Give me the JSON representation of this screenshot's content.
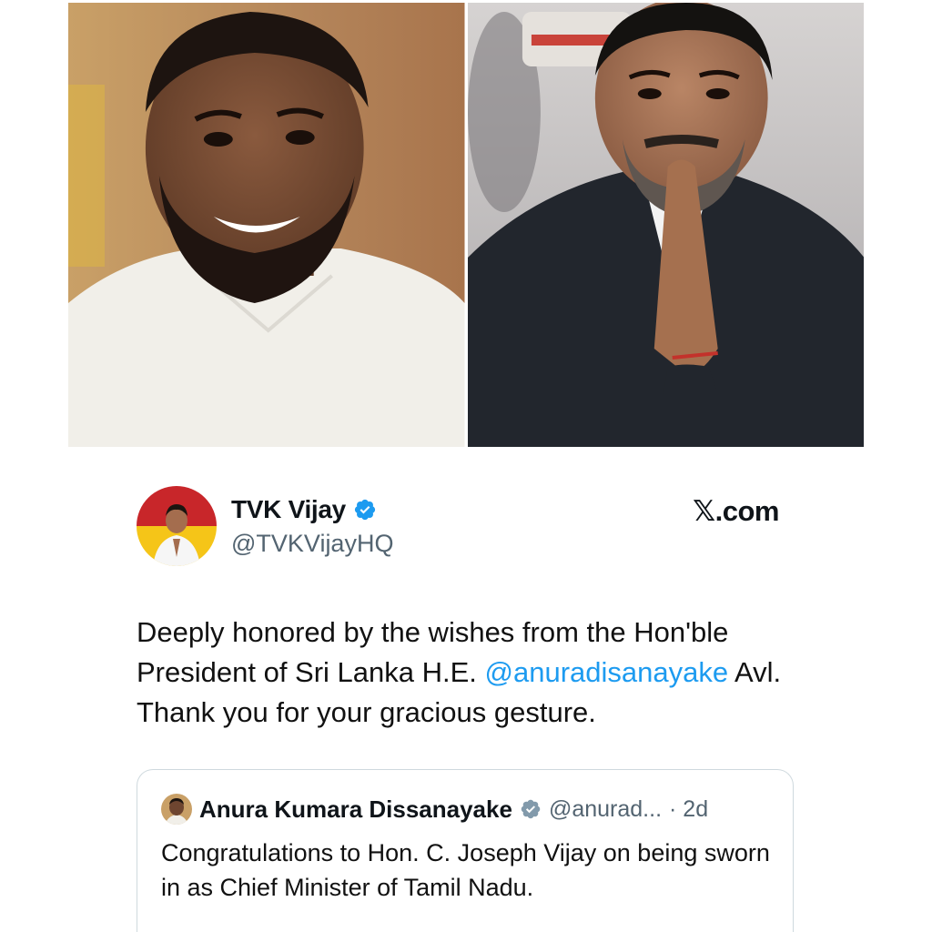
{
  "tweet": {
    "display_name": "TVK Vijay",
    "handle": "@TVKVijayHQ",
    "source": "𝕏.com",
    "text_before": "Deeply honored by the wishes from the Hon'ble President of Sri Lanka H.E. ",
    "mention": "@anuradisanayake",
    "text_after": " Avl. Thank you for your gracious gesture."
  },
  "quoted_tweet": {
    "display_name": "Anura Kumara Dissanayake",
    "handle": "@anurad...",
    "time": "· 2d",
    "text": "Congratulations to Hon. C. Joseph Vijay on being sworn in as Chief Minister of Tamil Nadu."
  },
  "colors": {
    "accent": "#1d9bf0",
    "muted_text": "#536471",
    "border": "#cfd9de"
  },
  "icons": [
    "verified-badge-icon",
    "x-logo-icon"
  ]
}
